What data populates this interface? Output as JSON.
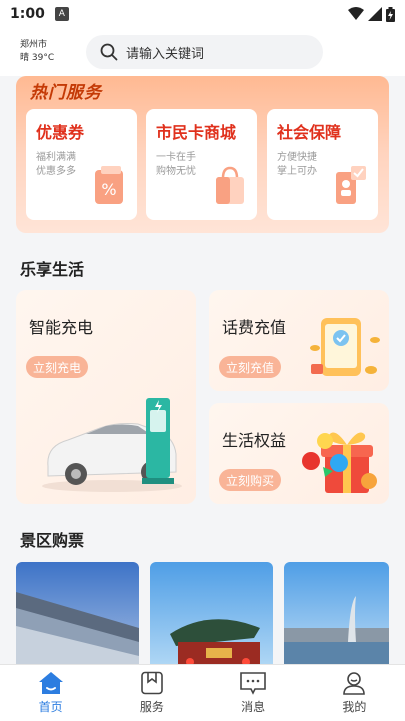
{
  "status_bar": {
    "time": "1:00",
    "a_icon": "A"
  },
  "header": {
    "city": "郑州市",
    "weather": "晴 39°C",
    "search_placeholder": "请输入关键词"
  },
  "hot_services": {
    "title": "热门服务",
    "items": [
      {
        "title": "优惠券",
        "line1": "福利满满",
        "line2": "优惠多多",
        "icon": "coupon-icon"
      },
      {
        "title": "市民卡商城",
        "line1": "一卡在手",
        "line2": "购物无忧",
        "icon": "shopping-bag-icon"
      },
      {
        "title": "社会保障",
        "line1": "方便快捷",
        "line2": "掌上可办",
        "icon": "phone-check-icon"
      }
    ]
  },
  "life": {
    "title": "乐享生活",
    "charging": {
      "title": "智能充电",
      "button": "立刻充电"
    },
    "phone_recharge": {
      "title": "话费充值",
      "button": "立刻充值"
    },
    "benefits": {
      "title": "生活权益",
      "button": "立刻购买"
    }
  },
  "scenic": {
    "title": "景区购票"
  },
  "tabs": [
    {
      "label": "首页",
      "icon": "home-icon",
      "active": true
    },
    {
      "label": "服务",
      "icon": "service-bookmark-icon",
      "active": false
    },
    {
      "label": "消息",
      "icon": "message-icon",
      "active": false
    },
    {
      "label": "我的",
      "icon": "user-icon",
      "active": false
    }
  ],
  "colors": {
    "accent": "#2c7de0",
    "hot_title": "#c43a06",
    "card_title": "#e0311d",
    "button_bg": "#f9b497"
  }
}
